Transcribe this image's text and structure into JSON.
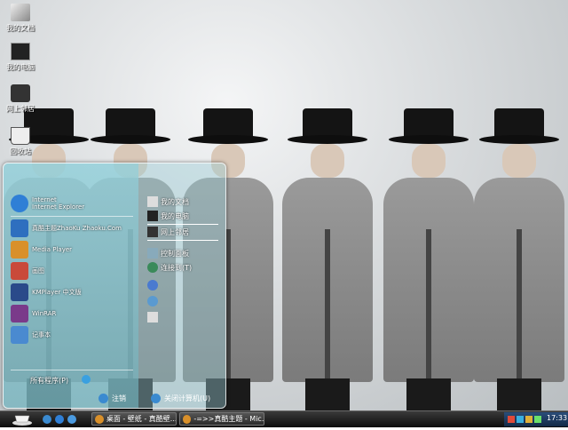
{
  "desktop": {
    "icons": [
      {
        "name": "my-documents-icon",
        "label": "我的文档"
      },
      {
        "name": "my-computer-icon",
        "label": "我的电脑"
      },
      {
        "name": "network-places-icon",
        "label": "网上邻居"
      },
      {
        "name": "recycle-bin-icon",
        "label": "回收站"
      }
    ]
  },
  "start_menu": {
    "pinned": [
      {
        "name": "internet-explorer",
        "line1": "Internet",
        "line2": "Internet Explorer",
        "color": "#2f7fd6"
      },
      {
        "name": "zhaoku-theme",
        "line1": "",
        "line2": "真酷主题ZhaoKu Zhaoku.Com",
        "color": "#2e6fbf"
      },
      {
        "name": "media-player",
        "line1": "",
        "line2": "Media Player",
        "color": "#d9902a"
      },
      {
        "name": "paint",
        "line1": "",
        "line2": "画图",
        "color": "#c94a3a"
      },
      {
        "name": "kmplayer",
        "line1": "",
        "line2": "KMPlayer 中文版",
        "color": "#2a4a8a"
      },
      {
        "name": "winrar",
        "line1": "",
        "line2": "WinRAR",
        "color": "#7a3a8a"
      },
      {
        "name": "notepad",
        "line1": "",
        "line2": "记事本",
        "color": "#4a8ad0"
      }
    ],
    "all_programs": "所有程序(P)",
    "right": [
      {
        "name": "my-documents",
        "label": "我的文档"
      },
      {
        "name": "my-computer",
        "label": "我的电脑"
      },
      {
        "name": "network",
        "label": "网上邻居"
      },
      {
        "name": "control-panel",
        "label": "控制面板"
      },
      {
        "name": "connect-to",
        "label": "连接到(T)"
      },
      {
        "name": "help",
        "label": ""
      },
      {
        "name": "search",
        "label": ""
      },
      {
        "name": "run",
        "label": ""
      }
    ],
    "logoff_label": "注销",
    "shutdown_label": "关闭计算机(U)"
  },
  "taskbar": {
    "tasks": [
      {
        "label": "桌面 - 壁纸 - 真酷壁..."
      },
      {
        "label": "-=>>真酷主题 - Mic..."
      }
    ],
    "clock": "17:33"
  }
}
